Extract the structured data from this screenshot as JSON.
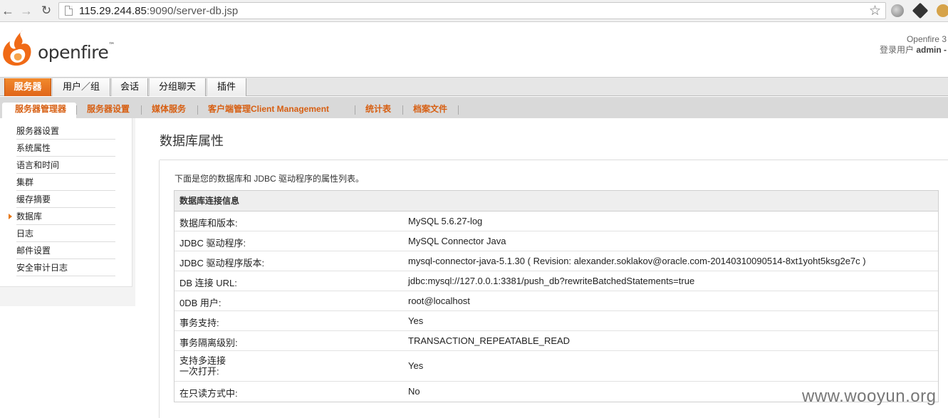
{
  "browser": {
    "url_host": "115.29.244.85",
    "url_rest": ":9090/server-db.jsp"
  },
  "header": {
    "brand": "openfire",
    "version_text": "Openfire 3",
    "login_label": "登录用户",
    "login_user": "admin -"
  },
  "main_tabs": [
    "服务器",
    "用户／组",
    "会话",
    "分组聊天",
    "插件"
  ],
  "sub_tabs": [
    "服务器管理器",
    "服务器设置",
    "媒体服务",
    "客户端管理Client Management",
    "统计表",
    "档案文件"
  ],
  "sidebar": {
    "items": [
      "服务器设置",
      "系统属性",
      "语言和时间",
      "集群",
      "缓存摘要",
      "数据库",
      "日志",
      "邮件设置",
      "安全审计日志"
    ],
    "active_index": 5
  },
  "content": {
    "title": "数据库属性",
    "intro": "下面是您的数据库和 JDBC 驱动程序的属性列表。",
    "table_header": "数据库连接信息",
    "rows": [
      {
        "key": "数据库和版本:",
        "value": "MySQL 5.6.27-log"
      },
      {
        "key": "JDBC 驱动程序:",
        "value": "MySQL Connector Java"
      },
      {
        "key": "JDBC 驱动程序版本:",
        "value": "mysql-connector-java-5.1.30 ( Revision: alexander.soklakov@oracle.com-20140310090514-8xt1yoht5ksg2e7c )"
      },
      {
        "key": "DB 连接 URL:",
        "value": "jdbc:mysql://127.0.0.1:3381/push_db?rewriteBatchedStatements=true"
      },
      {
        "key": "0DB 用户:",
        "value": "root@localhost"
      },
      {
        "key": "事务支持:",
        "value": "Yes"
      },
      {
        "key": "事务隔离级别:",
        "value": "TRANSACTION_REPEATABLE_READ"
      },
      {
        "key": "支持多连接\n一次打开:",
        "value": "Yes"
      },
      {
        "key": "在只读方式中:",
        "value": "No"
      }
    ]
  },
  "watermark": "www.wooyun.org",
  "colors": {
    "accent": "#e2691d",
    "tab_link": "#d75f12"
  }
}
